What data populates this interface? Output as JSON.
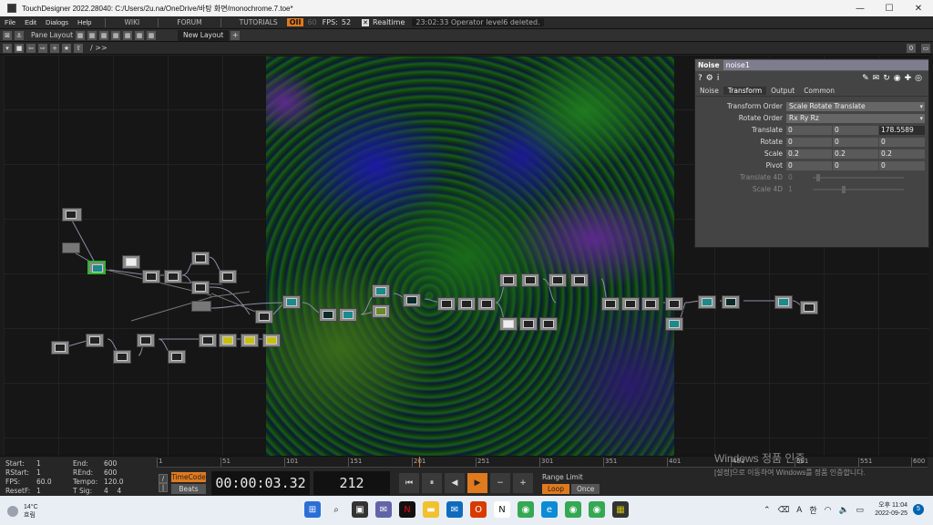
{
  "window": {
    "title": "TouchDesigner 2022.28040: C:/Users/2u.na/OneDrive/바탕 화면/monochrome.7.toe*",
    "minimize_glyph": "—",
    "maximize_glyph": "☐",
    "close_glyph": "✕"
  },
  "menubar": {
    "items": [
      "File",
      "Edit",
      "Dialogs",
      "Help"
    ],
    "links": [
      "WIKI",
      "FORUM",
      "TUTORIALS"
    ],
    "oii": "OII",
    "fps_dim": "60",
    "fps_label": "FPS:",
    "fps_value": "52",
    "realtime_label": "Realtime",
    "status": "23:02:33 Operator level6 deleted."
  },
  "panebar": {
    "pane_layout": "Pane Layout",
    "tab": "New Layout"
  },
  "pathbar": {
    "path": "/ >>",
    "right_value": "0"
  },
  "params": {
    "op_type": "Noise",
    "op_name": "noise1",
    "tabs": [
      "Noise",
      "Transform",
      "Output",
      "Common"
    ],
    "active_tab": "Transform",
    "rows": {
      "transform_order": {
        "label": "Transform Order",
        "value": "Scale Rotate Translate"
      },
      "rotate_order": {
        "label": "Rotate Order",
        "value": "Rx Ry Rz"
      },
      "translate": {
        "label": "Translate",
        "x": "0",
        "y": "0",
        "z": "178.5589"
      },
      "rotate": {
        "label": "Rotate",
        "x": "0",
        "y": "0",
        "z": "0"
      },
      "scale": {
        "label": "Scale",
        "x": "0.2",
        "y": "0.2",
        "z": "0.2"
      },
      "pivot": {
        "label": "Pivot",
        "x": "0",
        "y": "0",
        "z": "0"
      },
      "translate4d": {
        "label": "Translate 4D",
        "value": "0"
      },
      "scale4d": {
        "label": "Scale 4D",
        "value": "1"
      }
    }
  },
  "timeline": {
    "info": {
      "start_label": "Start:",
      "start": "1",
      "end_label": "End:",
      "end": "600",
      "rstart_label": "RStart:",
      "rstart": "1",
      "rend_label": "REnd:",
      "rend": "600",
      "fps_label": "FPS:",
      "fps": "60.0",
      "tempo_label": "Tempo:",
      "tempo": "120.0",
      "resetf_label": "ResetF:",
      "resetf": "1",
      "tsig_label": "T Sig:",
      "tsig_a": "4",
      "tsig_b": "4"
    },
    "ruler_ticks": [
      "1",
      "51",
      "101",
      "151",
      "201",
      "251",
      "301",
      "351",
      "401",
      "451",
      "501",
      "551",
      "600"
    ],
    "modes": {
      "timecode": "TimeCode",
      "beats": "Beats"
    },
    "timecode": "00:00:03.32",
    "frame": "212",
    "range_limit": "Range Limit",
    "loop": "Loop",
    "once": "Once"
  },
  "activation": {
    "line1": "Windows 정품 인증",
    "line2": "[설정]으로 이동하여 Windows를 정품 인증합니다."
  },
  "taskbar": {
    "weather_temp": "14°C",
    "weather_desc": "흐림",
    "lang_a": "A",
    "lang_ko": "한",
    "time": "오후 11:04",
    "date": "2022-09-25",
    "notif_count": "5"
  },
  "colors": {
    "accent": "#e07a1e",
    "selection": "#2bb52b",
    "opname_bg": "#7d7d8e"
  }
}
